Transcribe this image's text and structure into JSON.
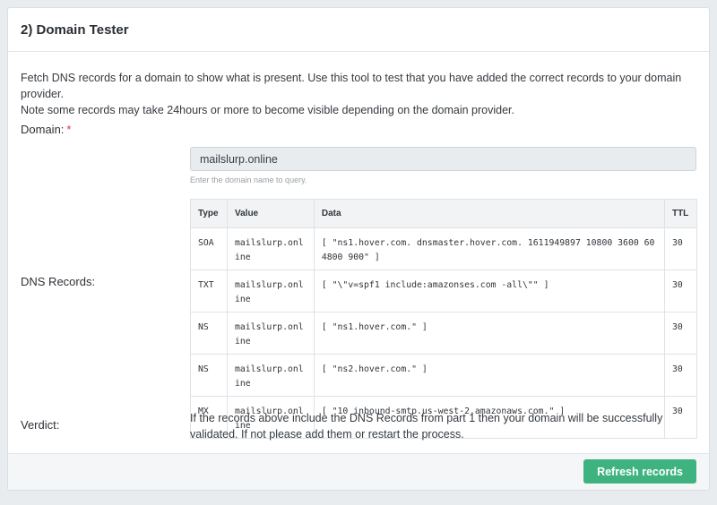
{
  "header": {
    "title": "2) Domain Tester"
  },
  "intro": {
    "line1": "Fetch DNS records for a domain to show what is present. Use this tool to test that you have added the correct records to your domain provider.",
    "line2": "Note some records may take 24hours or more to become visible depending on the domain provider."
  },
  "domain": {
    "label": "Domain:",
    "required_mark": "*",
    "value": "mailslurp.online",
    "help": "Enter the domain name to query."
  },
  "dns": {
    "label": "DNS Records:",
    "columns": [
      "Type",
      "Value",
      "Data",
      "TTL"
    ],
    "rows": [
      {
        "type": "SOA",
        "value": "mailslurp.online",
        "data": "[ \"ns1.hover.com. dnsmaster.hover.com. 1611949897 10800 3600 604800 900\" ]",
        "ttl": "30"
      },
      {
        "type": "TXT",
        "value": "mailslurp.online",
        "data": "[ \"\\\"v=spf1 include:amazonses.com -all\\\"\" ]",
        "ttl": "30"
      },
      {
        "type": "NS",
        "value": "mailslurp.online",
        "data": "[ \"ns1.hover.com.\" ]",
        "ttl": "30"
      },
      {
        "type": "NS",
        "value": "mailslurp.online",
        "data": "[ \"ns2.hover.com.\" ]",
        "ttl": "30"
      },
      {
        "type": "MX",
        "value": "mailslurp.online",
        "data": "[ \"10 inbound-smtp.us-west-2.amazonaws.com.\" ]",
        "ttl": "30"
      }
    ]
  },
  "verdict": {
    "label": "Verdict:",
    "text": "If the records above include the DNS Records from part 1 then your domain will be successfully validated. If not please add them or restart the process."
  },
  "footer": {
    "refresh_label": "Refresh records"
  },
  "colors": {
    "accent": "#3fb37f",
    "required": "#dc3545"
  }
}
